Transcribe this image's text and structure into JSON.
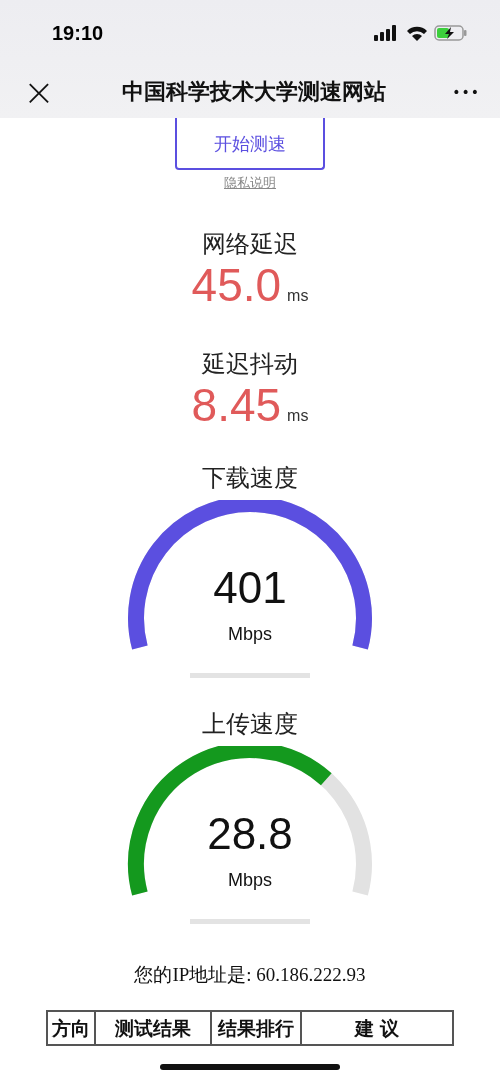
{
  "status_bar": {
    "time": "19:10"
  },
  "nav_bar": {
    "close": "×",
    "title": "中国科学技术大学测速网站",
    "more": "•••"
  },
  "start_button": {
    "label": "开始测速"
  },
  "privacy_link": {
    "label": "隐私说明"
  },
  "metrics": [
    {
      "label": "网络延迟",
      "value": "45.0",
      "unit": "ms"
    },
    {
      "label": "延迟抖动",
      "value": "8.45",
      "unit": "ms"
    }
  ],
  "gauges": [
    {
      "label": "下载速度",
      "value": "401",
      "unit": "Mbps",
      "color": "#5b4fe0"
    },
    {
      "label": "上传速度",
      "value": "28.8",
      "unit": "Mbps",
      "color": "#14991e"
    }
  ],
  "ip_text": "您的IP地址是: 60.186.222.93",
  "table": {
    "columns": [
      "方向",
      "测试结果",
      "结果排行",
      "建 议"
    ]
  }
}
